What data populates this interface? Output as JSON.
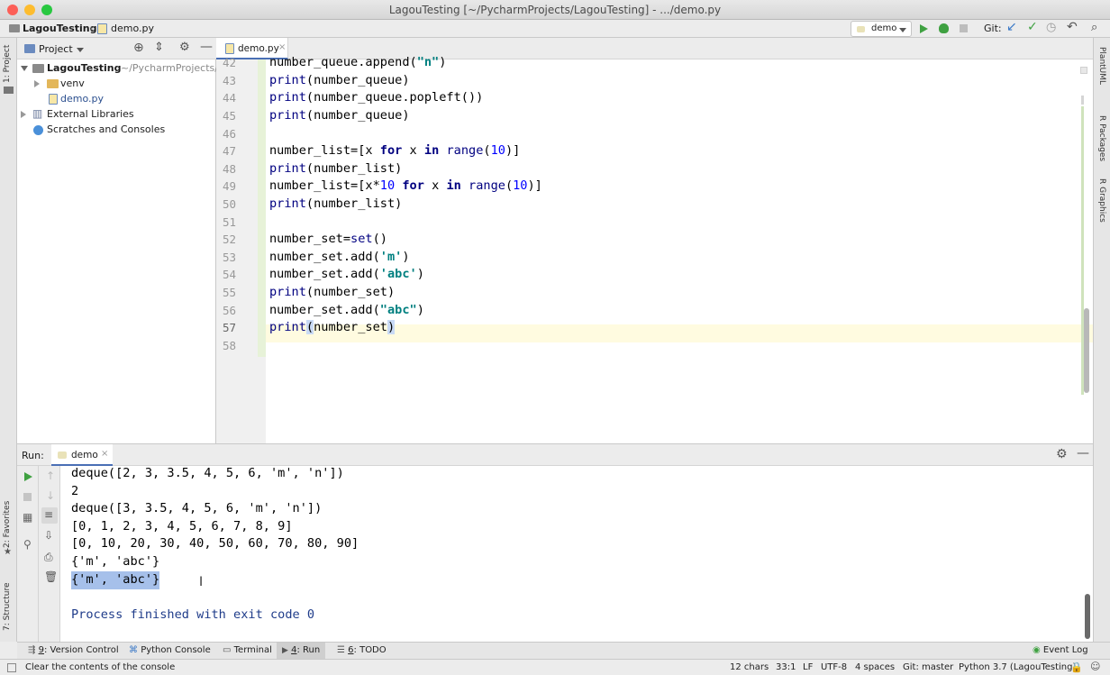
{
  "window": {
    "title": "LagouTesting [~/PycharmProjects/LagouTesting] - .../demo.py"
  },
  "navbar": {
    "crumb_project": "LagouTesting",
    "crumb_file": "demo.py",
    "run_config": "demo",
    "git_label": "Git:"
  },
  "left_strip": {
    "project_tab": "1: Project",
    "favorites_tab": "2: Favorites",
    "structure_tab": "7: Structure"
  },
  "right_strip": {
    "tabs": [
      "PlantUML",
      "R Packages",
      "R Graphics"
    ]
  },
  "project_panel": {
    "header": "Project",
    "tree": [
      {
        "label": "LagouTesting",
        "suffix": "~/PycharmProjects/L"
      },
      {
        "label": "venv"
      },
      {
        "label": "demo.py"
      },
      {
        "label": "External Libraries"
      },
      {
        "label": "Scratches and Consoles"
      }
    ]
  },
  "editor": {
    "tab": "demo.py",
    "line_numbers": [
      "42",
      "43",
      "44",
      "45",
      "46",
      "47",
      "48",
      "49",
      "50",
      "51",
      "52",
      "53",
      "54",
      "55",
      "56",
      "57",
      "58"
    ]
  },
  "run": {
    "label": "Run:",
    "tab": "demo",
    "output": [
      "deque([2, 3, 3.5, 4, 5, 6, 'm', 'n'])",
      "2",
      "deque([3, 3.5, 4, 5, 6, 'm', 'n'])",
      "[0, 1, 2, 3, 4, 5, 6, 7, 8, 9]",
      "[0, 10, 20, 30, 40, 50, 60, 70, 80, 90]",
      "{'m', 'abc'}",
      "{'m', 'abc'}",
      "",
      "Process finished with exit code 0"
    ]
  },
  "tool_windows": [
    {
      "key": "9",
      "label": ": Version Control"
    },
    {
      "key": "",
      "label": "Python Console"
    },
    {
      "key": "",
      "label": "Terminal"
    },
    {
      "key": "4",
      "label": ": Run"
    },
    {
      "key": "6",
      "label": ": TODO"
    }
  ],
  "event_log": "Event Log",
  "status": {
    "message": "Clear the contents of the console",
    "chars": "12 chars",
    "position": "33:1",
    "line_sep": "LF",
    "encoding": "UTF-8",
    "indent": "4 spaces",
    "git": "Git: master",
    "interpreter": "Python 3.7 (LagouTesting)"
  },
  "colors": {
    "accent": "#4a6fb5",
    "selection": "#a6c0ea",
    "run_green": "#3fa141",
    "folder": "#e3b75a",
    "caret_row": "#fffbe0"
  }
}
